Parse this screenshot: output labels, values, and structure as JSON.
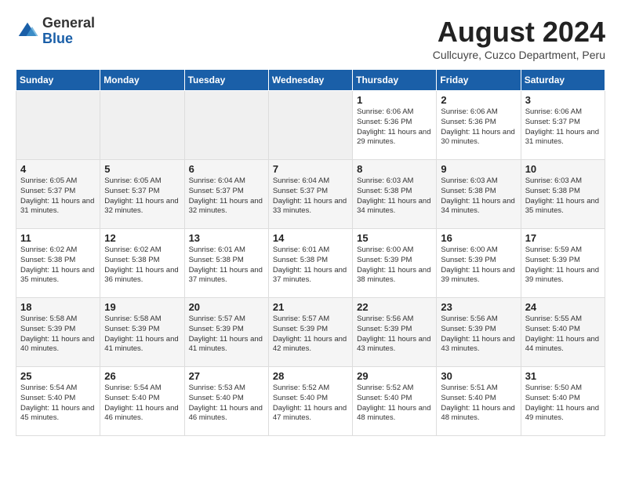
{
  "header": {
    "logo_general": "General",
    "logo_blue": "Blue",
    "month_year": "August 2024",
    "location": "Cullcuyre, Cuzco Department, Peru"
  },
  "weekdays": [
    "Sunday",
    "Monday",
    "Tuesday",
    "Wednesday",
    "Thursday",
    "Friday",
    "Saturday"
  ],
  "weeks": [
    [
      {
        "num": "",
        "empty": true
      },
      {
        "num": "",
        "empty": true
      },
      {
        "num": "",
        "empty": true
      },
      {
        "num": "",
        "empty": true
      },
      {
        "num": "1",
        "sunrise": "6:06 AM",
        "sunset": "5:36 PM",
        "daylight": "11 hours and 29 minutes."
      },
      {
        "num": "2",
        "sunrise": "6:06 AM",
        "sunset": "5:36 PM",
        "daylight": "11 hours and 30 minutes."
      },
      {
        "num": "3",
        "sunrise": "6:06 AM",
        "sunset": "5:37 PM",
        "daylight": "11 hours and 31 minutes."
      }
    ],
    [
      {
        "num": "4",
        "sunrise": "6:05 AM",
        "sunset": "5:37 PM",
        "daylight": "11 hours and 31 minutes."
      },
      {
        "num": "5",
        "sunrise": "6:05 AM",
        "sunset": "5:37 PM",
        "daylight": "11 hours and 32 minutes."
      },
      {
        "num": "6",
        "sunrise": "6:04 AM",
        "sunset": "5:37 PM",
        "daylight": "11 hours and 32 minutes."
      },
      {
        "num": "7",
        "sunrise": "6:04 AM",
        "sunset": "5:37 PM",
        "daylight": "11 hours and 33 minutes."
      },
      {
        "num": "8",
        "sunrise": "6:03 AM",
        "sunset": "5:38 PM",
        "daylight": "11 hours and 34 minutes."
      },
      {
        "num": "9",
        "sunrise": "6:03 AM",
        "sunset": "5:38 PM",
        "daylight": "11 hours and 34 minutes."
      },
      {
        "num": "10",
        "sunrise": "6:03 AM",
        "sunset": "5:38 PM",
        "daylight": "11 hours and 35 minutes."
      }
    ],
    [
      {
        "num": "11",
        "sunrise": "6:02 AM",
        "sunset": "5:38 PM",
        "daylight": "11 hours and 35 minutes."
      },
      {
        "num": "12",
        "sunrise": "6:02 AM",
        "sunset": "5:38 PM",
        "daylight": "11 hours and 36 minutes."
      },
      {
        "num": "13",
        "sunrise": "6:01 AM",
        "sunset": "5:38 PM",
        "daylight": "11 hours and 37 minutes."
      },
      {
        "num": "14",
        "sunrise": "6:01 AM",
        "sunset": "5:38 PM",
        "daylight": "11 hours and 37 minutes."
      },
      {
        "num": "15",
        "sunrise": "6:00 AM",
        "sunset": "5:39 PM",
        "daylight": "11 hours and 38 minutes."
      },
      {
        "num": "16",
        "sunrise": "6:00 AM",
        "sunset": "5:39 PM",
        "daylight": "11 hours and 39 minutes."
      },
      {
        "num": "17",
        "sunrise": "5:59 AM",
        "sunset": "5:39 PM",
        "daylight": "11 hours and 39 minutes."
      }
    ],
    [
      {
        "num": "18",
        "sunrise": "5:58 AM",
        "sunset": "5:39 PM",
        "daylight": "11 hours and 40 minutes."
      },
      {
        "num": "19",
        "sunrise": "5:58 AM",
        "sunset": "5:39 PM",
        "daylight": "11 hours and 41 minutes."
      },
      {
        "num": "20",
        "sunrise": "5:57 AM",
        "sunset": "5:39 PM",
        "daylight": "11 hours and 41 minutes."
      },
      {
        "num": "21",
        "sunrise": "5:57 AM",
        "sunset": "5:39 PM",
        "daylight": "11 hours and 42 minutes."
      },
      {
        "num": "22",
        "sunrise": "5:56 AM",
        "sunset": "5:39 PM",
        "daylight": "11 hours and 43 minutes."
      },
      {
        "num": "23",
        "sunrise": "5:56 AM",
        "sunset": "5:39 PM",
        "daylight": "11 hours and 43 minutes."
      },
      {
        "num": "24",
        "sunrise": "5:55 AM",
        "sunset": "5:40 PM",
        "daylight": "11 hours and 44 minutes."
      }
    ],
    [
      {
        "num": "25",
        "sunrise": "5:54 AM",
        "sunset": "5:40 PM",
        "daylight": "11 hours and 45 minutes."
      },
      {
        "num": "26",
        "sunrise": "5:54 AM",
        "sunset": "5:40 PM",
        "daylight": "11 hours and 46 minutes."
      },
      {
        "num": "27",
        "sunrise": "5:53 AM",
        "sunset": "5:40 PM",
        "daylight": "11 hours and 46 minutes."
      },
      {
        "num": "28",
        "sunrise": "5:52 AM",
        "sunset": "5:40 PM",
        "daylight": "11 hours and 47 minutes."
      },
      {
        "num": "29",
        "sunrise": "5:52 AM",
        "sunset": "5:40 PM",
        "daylight": "11 hours and 48 minutes."
      },
      {
        "num": "30",
        "sunrise": "5:51 AM",
        "sunset": "5:40 PM",
        "daylight": "11 hours and 48 minutes."
      },
      {
        "num": "31",
        "sunrise": "5:50 AM",
        "sunset": "5:40 PM",
        "daylight": "11 hours and 49 minutes."
      }
    ]
  ]
}
